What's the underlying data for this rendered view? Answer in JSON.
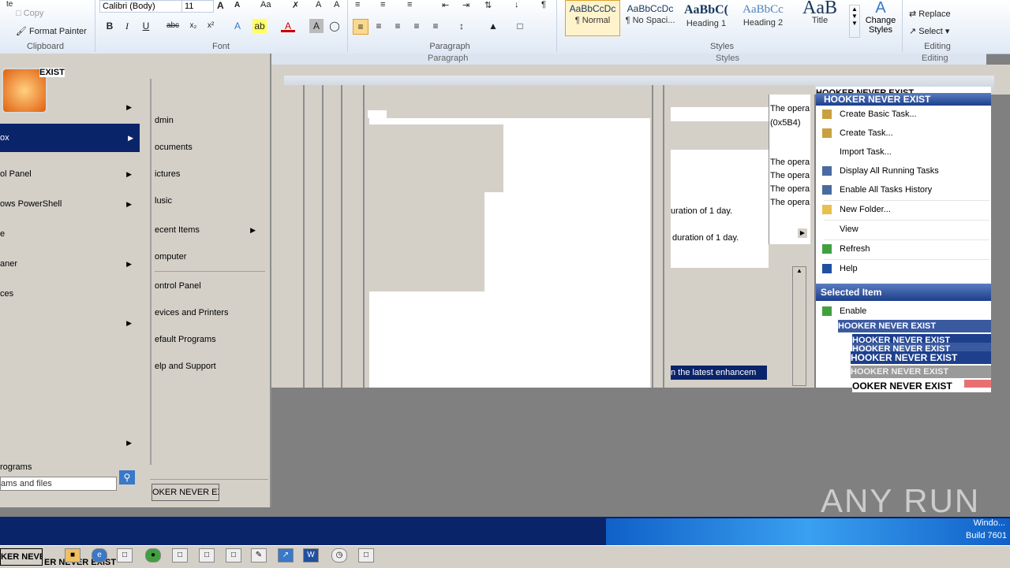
{
  "ribbon": {
    "clipboard": {
      "copy": "Copy",
      "format_painter": "Format Painter",
      "label": "Clipboard"
    },
    "font": {
      "name": "Calibri (Body)",
      "size": "11",
      "label": "Font"
    },
    "paragraph": {
      "label": "Paragraph"
    },
    "styles": {
      "label": "Styles",
      "items": [
        {
          "sample": "AaBbCcDc",
          "name": "¶ Normal"
        },
        {
          "sample": "AaBbCcDc",
          "name": "¶ No Spaci..."
        },
        {
          "sample": "AaBbC(",
          "name": "Heading 1"
        },
        {
          "sample": "AaBbCc",
          "name": "Heading 2"
        },
        {
          "sample": "AaB",
          "name": "Title"
        }
      ],
      "change_styles": "Change Styles"
    },
    "editing": {
      "replace": "Replace",
      "select": "Select",
      "label": "Editing"
    },
    "echo": {
      "paragraph": "Paragraph",
      "styles": "Styles",
      "editing": "Editing"
    }
  },
  "start_menu": {
    "user_label": "EXIST",
    "left_items": [
      {
        "label": "",
        "arrow": true
      },
      {
        "label": "ox",
        "arrow": true
      },
      {
        "label": "ol Panel",
        "arrow": true
      },
      {
        "label": "ows PowerShell",
        "arrow": true
      },
      {
        "label": "e",
        "arrow": false
      },
      {
        "label": "aner",
        "arrow": true
      },
      {
        "label": "ces",
        "arrow": false
      },
      {
        "label": "",
        "arrow": true
      },
      {
        "label": "",
        "arrow": true
      }
    ],
    "programs": "rograms",
    "search_placeholder": "ams and files",
    "right_items": [
      {
        "label": "dmin"
      },
      {
        "label": "ocuments"
      },
      {
        "label": "ictures"
      },
      {
        "label": "lusic"
      },
      {
        "label": "ecent Items",
        "arrow": true
      },
      {
        "label": "omputer"
      },
      {
        "label": "ontrol Panel"
      },
      {
        "label": "evices and Printers"
      },
      {
        "label": "efault Programs"
      },
      {
        "label": "elp and Support"
      }
    ],
    "shutdown_label": "OKER NEVER EXIS"
  },
  "middle": {
    "col_texts": [
      "The opera",
      "(0x5B4)",
      "The opera",
      "The opera",
      "The opera",
      "The opera"
    ],
    "duration1": "uration of 1 day.",
    "duration2": "duration of 1 day.",
    "highlight": "n the latest enhancem"
  },
  "actions": {
    "header": "HOOKER NEVER EXIST",
    "items": [
      {
        "label": "Create Basic Task...",
        "icon_color": "#c8a040"
      },
      {
        "label": "Create Task...",
        "icon_color": "#c8a040"
      },
      {
        "label": "Import Task...",
        "icon_color": "#ffffff"
      },
      {
        "label": "Display All Running Tasks",
        "icon_color": "#4a6aa0"
      },
      {
        "label": "Enable All Tasks History",
        "icon_color": "#4a6aa0"
      },
      {
        "label": "New Folder...",
        "icon_color": "#e8c050"
      },
      {
        "label": "View",
        "icon_color": "#ffffff"
      },
      {
        "label": "Refresh",
        "icon_color": "#40a040"
      },
      {
        "label": "Help",
        "icon_color": "#2050a0"
      }
    ],
    "selected_header": "Selected Item",
    "enable": "Enable",
    "enable_echo": "Enable",
    "hooker_texts": [
      "HOOKER NEVER EXIST",
      "HOOKER NEVER EXIST",
      "HOOKER NEVER EXIST",
      "HOOKER NEVER EXIST",
      "HOOKER NEVER EXIST",
      "OOKER NEVER EXIST"
    ],
    "top_echo": "HOOKER NEVER EXIST"
  },
  "taskbar": {
    "start_label": "KER NEVE",
    "below_label": "ER NEVER EXIST",
    "windows_text": "Windo...",
    "build": "Build 7601"
  },
  "watermark": "ANY RUN"
}
